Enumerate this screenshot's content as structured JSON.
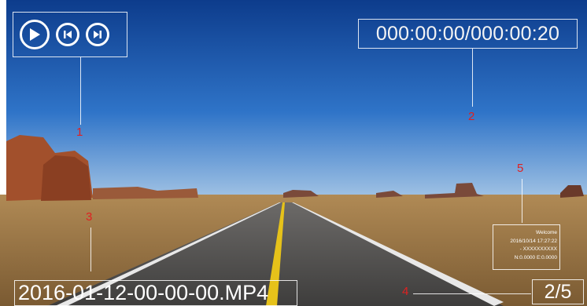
{
  "player": {
    "controls": [
      "play-button",
      "previous-button",
      "next-button"
    ],
    "elapsed_total": "000:00:00/000:00:20",
    "filename": "2016-01-12-00-00-00.MP4",
    "page": "2/5",
    "stamp": {
      "line1": "Welcome",
      "line2": "2016/10/14 17:27:22",
      "line3": "- XXXXXXXXXX",
      "line4": "N:0.0000  E:0.0000"
    }
  },
  "callouts": {
    "c1": "1",
    "c2": "2",
    "c3": "3",
    "c4": "4",
    "c5": "5"
  },
  "colors": {
    "callout": "#e02020",
    "overlay": "#ffffff"
  }
}
